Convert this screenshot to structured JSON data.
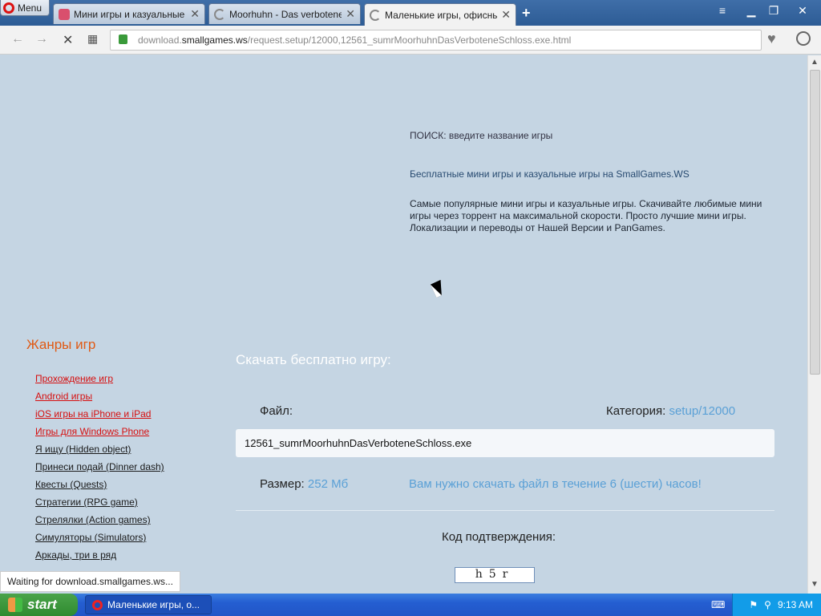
{
  "browser": {
    "menu_label": "Menu",
    "tabs": [
      {
        "label": "Мини игры и казуальные и",
        "active": false,
        "icon": "game-favicon-icon"
      },
      {
        "label": "Moorhuhn - Das verbotene S",
        "active": false,
        "icon": "loading-icon"
      },
      {
        "label": "Маленькие игры, офисные",
        "active": true,
        "icon": "loading-icon"
      }
    ],
    "new_tab_glyph": "+",
    "url_prefix": "download.",
    "url_host": "smallgames.ws",
    "url_path": "/request.setup/12000,12561_sumrMoorhuhnDasVerboteneSchloss.exe.html",
    "status_text": "Waiting for download.smallgames.ws..."
  },
  "page": {
    "search_label": "ПОИСК: введите название игры",
    "site_title": "Бесплатные мини игры и казуальные игры на SmallGames.WS",
    "site_description": "Самые популярные мини игры и казуальные игры. Скачивайте любимые мини игры через торрент на максимальной скорости. Просто лучшие мини игры. Локализации и переводы от Нашей Версии и PanGames.",
    "genres_title": "Жанры игр",
    "genres": [
      {
        "label": "Прохождение игр",
        "highlight": true
      },
      {
        "label": "Android игры",
        "highlight": true
      },
      {
        "label": "iOS игры на iPhone и iPad",
        "highlight": true
      },
      {
        "label": "Игры для Windows Phone",
        "highlight": true
      },
      {
        "label": "Я ищу (Hidden object)",
        "highlight": false
      },
      {
        "label": "Принеси подай (Dinner dash)",
        "highlight": false
      },
      {
        "label": "Квесты (Quests)",
        "highlight": false
      },
      {
        "label": "Стратегии (RPG game)",
        "highlight": false
      },
      {
        "label": "Стрелялки (Action games)",
        "highlight": false
      },
      {
        "label": "Симуляторы (Simulators)",
        "highlight": false
      },
      {
        "label": "Аркады, три в ряд",
        "highlight": false
      }
    ],
    "download_title": "Скачать бесплатно игру:",
    "file_label": "Файл:",
    "category_label": "Категория:",
    "category_value": "setup/12000",
    "file_name": "12561_sumrMoorhuhnDasVerboteneSchloss.exe",
    "size_label": "Размер:",
    "size_value": "252 Мб",
    "download_notice": "Вам нужно скачать файл в течение 6 (шести) часов!",
    "captcha_label": "Код подтверждения:",
    "captcha_text": "h5r"
  },
  "taskbar": {
    "start_label": "start",
    "task_label": "Маленькие игры, о...",
    "clock": "9:13 AM"
  }
}
